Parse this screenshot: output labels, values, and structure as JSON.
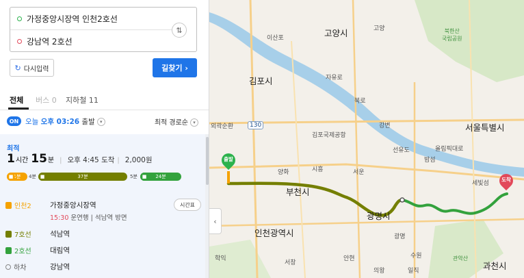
{
  "route": {
    "from": "가정중앙시장역 인천2호선",
    "to": "강남역 2호선"
  },
  "buttons": {
    "reset": "다시입력",
    "search": "길찾기 ›"
  },
  "tabs": [
    {
      "label": "전체"
    },
    {
      "label": "버스 0"
    },
    {
      "label": "지하철 11"
    }
  ],
  "options": {
    "on_badge": "ON",
    "depart_prefix": "오늘 ",
    "depart_time": "오후 03:26",
    "depart_suffix": " 출발",
    "sort": "최적 경로순"
  },
  "result": {
    "tag": "최적",
    "hours": "1",
    "hours_unit": "시간",
    "minutes": "15",
    "minutes_unit": "분",
    "arrival": "오후 4:45 도착",
    "fare": "2,000원",
    "bar": {
      "seg1": "1분",
      "gap1": "4분",
      "seg2": "37분",
      "gap2": "5분",
      "seg3": "24분"
    },
    "steps": [
      {
        "line": "인천2",
        "station": "가정중앙시장역",
        "line_color": "#f5a200"
      },
      {
        "line": "7호선",
        "station": "석남역",
        "line_color": "#747f00"
      },
      {
        "line": "2호선",
        "station": "대림역",
        "line_color": "#33a23d"
      },
      {
        "line": "하차",
        "station": "강남역",
        "line_color": "#888888"
      }
    ],
    "step1_sub_time": "15:30",
    "step1_sub_rest": " 운연행 | 석남역 방면",
    "timetable": "시간표"
  },
  "map": {
    "labels": [
      "고양시",
      "김포시",
      "서울특별시",
      "부천시",
      "광명시",
      "인천광역시",
      "과천시",
      "이산포",
      "고양",
      "북한산\n국립공원",
      "김포국제공항",
      "선유도",
      "밤섬",
      "세빛섬",
      "자유로",
      "북로",
      "시흥",
      "서운",
      "광명",
      "관악산",
      "일직",
      "외곽순환",
      "강변",
      "올림픽대로",
      "양화",
      "130",
      "학익",
      "서창",
      "안현",
      "수원",
      "의왕"
    ],
    "pin_start": "출발",
    "pin_end": "도착"
  },
  "colors": {
    "accent": "#1f75e8",
    "line_incheon2": "#f5a200",
    "line_7": "#747f00",
    "line_2": "#33a23d",
    "river": "#a7cfe9"
  }
}
